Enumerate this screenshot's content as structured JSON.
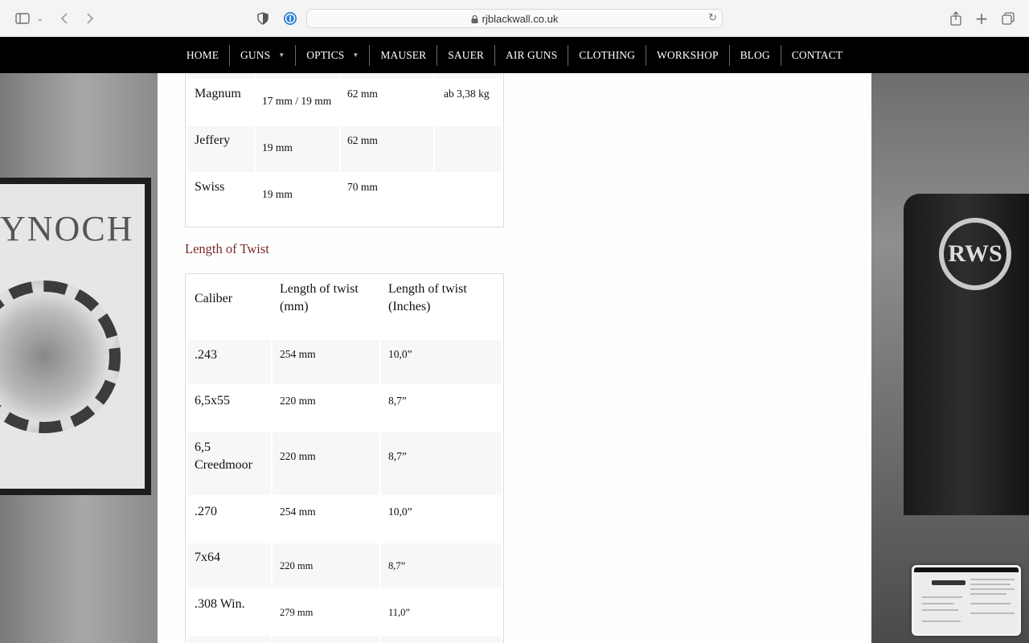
{
  "browser": {
    "url": "rjblackwall.co.uk"
  },
  "nav": {
    "items": [
      {
        "label": "HOME",
        "has_dropdown": false
      },
      {
        "label": "GUNS",
        "has_dropdown": true
      },
      {
        "label": "OPTICS",
        "has_dropdown": true
      },
      {
        "label": "MAUSER",
        "has_dropdown": false
      },
      {
        "label": "SAUER",
        "has_dropdown": false
      },
      {
        "label": "AIR GUNS",
        "has_dropdown": false
      },
      {
        "label": "CLOTHING",
        "has_dropdown": false
      },
      {
        "label": "WORKSHOP",
        "has_dropdown": false
      },
      {
        "label": "BLOG",
        "has_dropdown": false
      },
      {
        "label": "CONTACT",
        "has_dropdown": false
      }
    ]
  },
  "action_table": {
    "rows": [
      {
        "name": "Magnum",
        "bolt": "17 mm / 19 mm",
        "length": "62 mm",
        "weight": "ab 3,38 kg"
      },
      {
        "name": "Jeffery",
        "bolt": "19 mm",
        "length": "62 mm",
        "weight": ""
      },
      {
        "name": "Swiss",
        "bolt": "19 mm",
        "length": "70 mm",
        "weight": ""
      }
    ]
  },
  "twist": {
    "title": "Length of Twist",
    "headers": {
      "caliber": "Caliber",
      "mm": "Length of twist (mm)",
      "inches": "Length of twist (Inches)"
    },
    "rows": [
      {
        "caliber": ".243",
        "mm": "254 mm",
        "inches": "10,0”"
      },
      {
        "caliber": "6,5x55",
        "mm": "220 mm",
        "inches": "8,7”"
      },
      {
        "caliber": "6,5 Creedmoor",
        "mm": "220 mm",
        "inches": "8,7”"
      },
      {
        "caliber": ".270",
        "mm": "254 mm",
        "inches": "10,0”"
      },
      {
        "caliber": "7x64",
        "mm": "220 mm",
        "inches": "8,7”"
      },
      {
        "caliber": ".308 Win.",
        "mm": "279 mm",
        "inches": "11,0”"
      }
    ]
  },
  "background": {
    "poster_text": "YNOCH",
    "logo_text": "RWS"
  }
}
